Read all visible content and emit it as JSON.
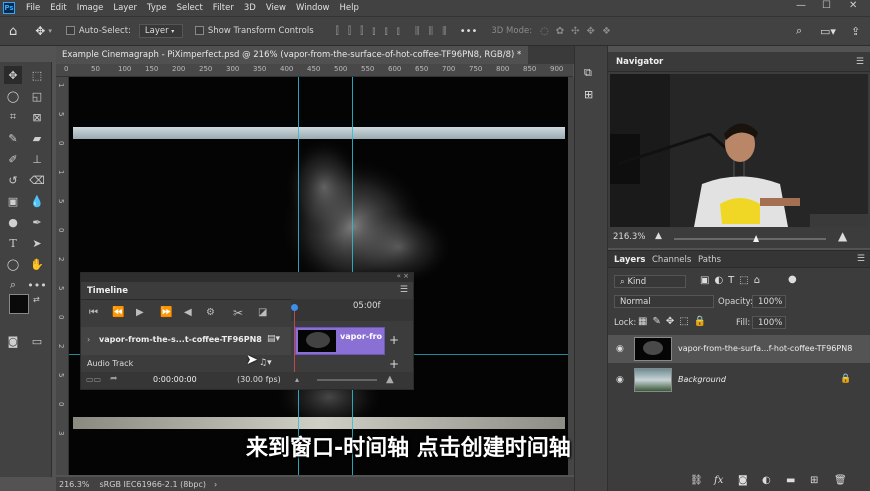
{
  "menubar": {
    "app_logo": "Ps",
    "items": [
      "File",
      "Edit",
      "Image",
      "Layer",
      "Type",
      "Select",
      "Filter",
      "3D",
      "View",
      "Window",
      "Help"
    ],
    "win_minimize": "—",
    "win_maximize": "☐",
    "win_close": "✕"
  },
  "options": {
    "auto_select_label": "Auto-Select:",
    "auto_select_target": "Layer",
    "show_transform_label": "Show Transform Controls",
    "mode_3d_label": "3D Mode:",
    "more": "•••"
  },
  "document": {
    "tab_title": "Example Cinemagraph - PiXimperfect.psd @ 216% (vapor-from-the-surface-of-hot-coffee-TF96PN8, RGB/8) *",
    "close": "×",
    "ruler_top": [
      "0",
      "50",
      "100",
      "150",
      "200",
      "250",
      "300",
      "350",
      "400",
      "450",
      "500",
      "550",
      "600",
      "650",
      "700",
      "750",
      "800",
      "850",
      "900"
    ],
    "ruler_left": [
      "1",
      "5",
      "0",
      "1",
      "5",
      "0",
      "2",
      "5",
      "0",
      "2",
      "5",
      "0",
      "3"
    ]
  },
  "status": {
    "zoom": "216.3%",
    "profile": "sRGB IEC61966-2.1 (8bpc)",
    "arrow": "›"
  },
  "timeline": {
    "title": "Timeline",
    "time_marker": "05:00f",
    "track_name": "vapor-from-the-s...t-coffee-TF96PN8",
    "clip_label": "vapor-fro",
    "audio_track_label": "Audio Track",
    "current_time": "0:00:00:00",
    "fps": "(30.00 fps)",
    "add": "+"
  },
  "navigator": {
    "title": "Navigator",
    "zoom": "216.3%",
    "zoom_slider_fraction": 0.54
  },
  "layers": {
    "tabs": [
      "Layers",
      "Channels",
      "Paths"
    ],
    "filter_kind": "Kind",
    "blend_mode": "Normal",
    "opacity_label": "Opacity:",
    "opacity_value": "100%",
    "lock_label": "Lock:",
    "fill_label": "Fill:",
    "fill_value": "100%",
    "items": [
      {
        "name": "vapor-from-the-surfa...f-hot-coffee-TF96PN8",
        "italic": false
      },
      {
        "name": "Background",
        "italic": true
      }
    ],
    "bottom_icons": [
      "link-icon",
      "fx-icon",
      "mask-icon",
      "adjustment-icon",
      "group-icon",
      "new-layer-icon",
      "trash-icon"
    ],
    "fx_label": "fx"
  },
  "subtitle": "来到窗口-时间轴 点击创建时间轴",
  "colors": {
    "guide": "#2fc0d8",
    "clip": "#8a6fd4",
    "playhead": "#3c8fe6",
    "accent_blue": "#31a8ff"
  }
}
